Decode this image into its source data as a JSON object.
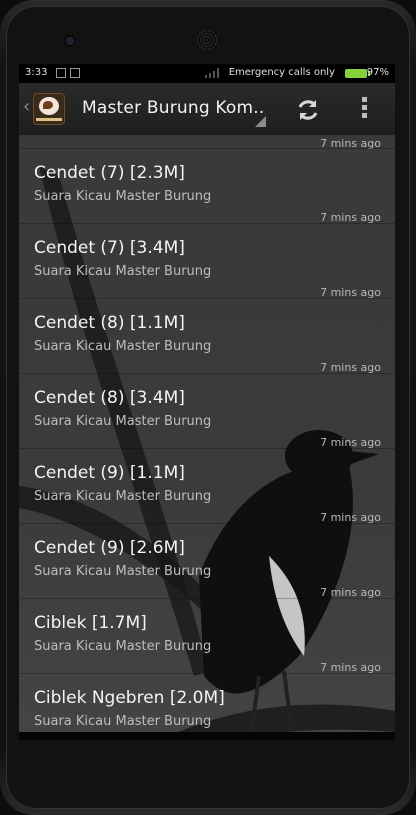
{
  "statusbar": {
    "time": "3:33",
    "emergency_text": "Emergency calls only",
    "battery_percent": "97%",
    "battery_color": "#86d23a"
  },
  "actionbar": {
    "title": "Master Burung Kom..",
    "up_icon": "chevron-left-icon",
    "refresh_icon": "refresh-icon",
    "overflow_icon": "overflow-menu-icon"
  },
  "list": {
    "top_time": "7 mins ago",
    "items": [
      {
        "title": "Cendet (7) [2.3M]",
        "subtitle": "Suara Kicau Master Burung",
        "time": "7 mins ago"
      },
      {
        "title": "Cendet (7) [3.4M]",
        "subtitle": "Suara Kicau Master Burung",
        "time": "7 mins ago"
      },
      {
        "title": "Cendet (8) [1.1M]",
        "subtitle": "Suara Kicau Master Burung",
        "time": "7 mins ago"
      },
      {
        "title": "Cendet (8) [3.4M]",
        "subtitle": "Suara Kicau Master Burung",
        "time": "7 mins ago"
      },
      {
        "title": "Cendet (9) [1.1M]",
        "subtitle": "Suara Kicau Master Burung",
        "time": "7 mins ago"
      },
      {
        "title": "Cendet (9) [2.6M]",
        "subtitle": "Suara Kicau Master Burung",
        "time": "7 mins ago"
      },
      {
        "title": "Ciblek [1.7M]",
        "subtitle": "Suara Kicau Master Burung",
        "time": "7 mins ago"
      },
      {
        "title": "Ciblek Ngebren [2.0M]",
        "subtitle": "Suara Kicau Master Burung",
        "time": ""
      }
    ]
  }
}
